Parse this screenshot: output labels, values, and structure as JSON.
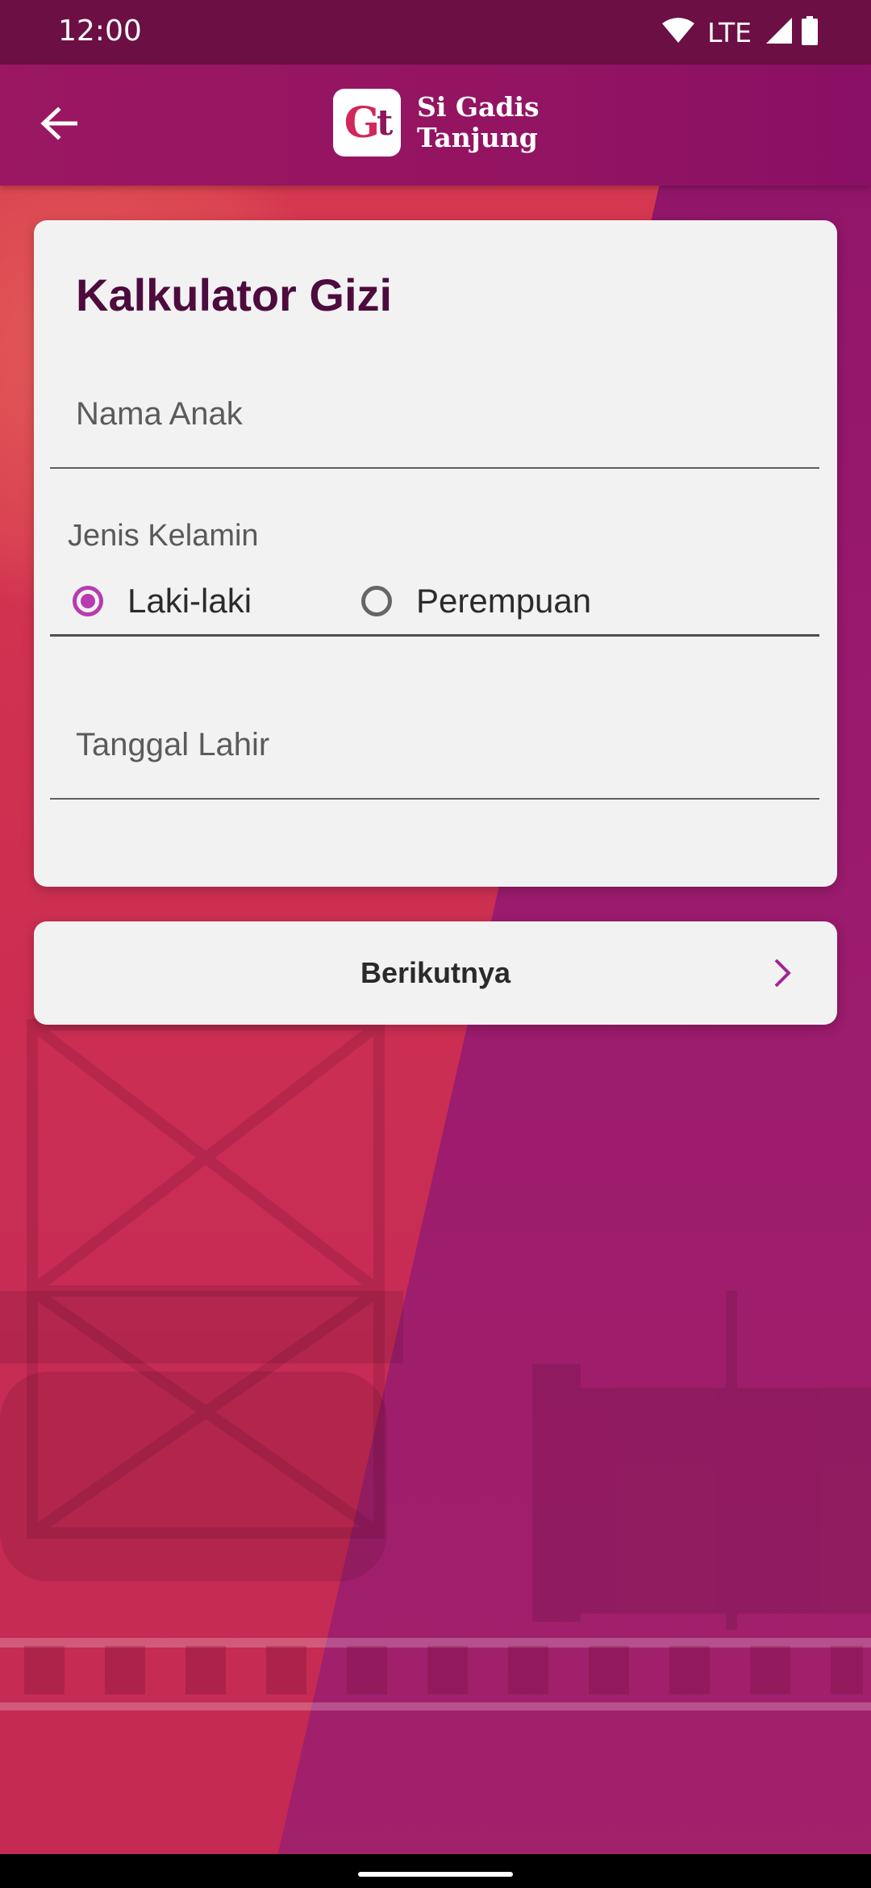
{
  "status_bar": {
    "time": "12:00",
    "network": "LTE",
    "icons": [
      "wifi-icon",
      "cell-signal-icon",
      "battery-icon"
    ]
  },
  "app_bar": {
    "back_icon": "arrow-left-icon",
    "logo_mark": {
      "g": "G",
      "t": "t"
    },
    "logo_line1": "Si Gadis",
    "logo_line2": "Tanjung"
  },
  "form": {
    "title": "Kalkulator Gizi",
    "name_field": {
      "placeholder": "Nama Anak",
      "value": ""
    },
    "gender": {
      "label": "Jenis Kelamin",
      "options": [
        {
          "label": "Laki-laki",
          "selected": true
        },
        {
          "label": "Perempuan",
          "selected": false
        }
      ]
    },
    "birthdate_field": {
      "placeholder": "Tanggal Lahir",
      "value": ""
    }
  },
  "next_button": {
    "label": "Berikutnya",
    "icon": "chevron-right-icon"
  },
  "colors": {
    "status_bar": "#6c0f44",
    "app_bar": "#9b1762",
    "title_text": "#4d0b3e",
    "radio_accent": "#b83bb0",
    "chevron": "#a3249b",
    "card_bg": "#f2f2f2"
  }
}
